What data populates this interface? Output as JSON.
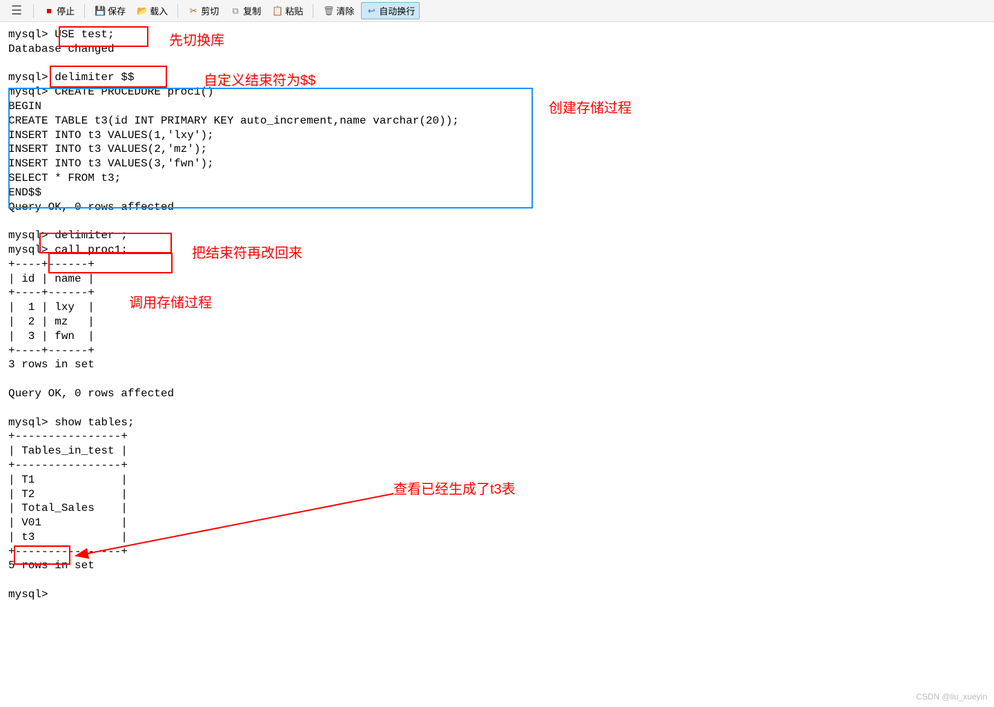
{
  "toolbar": {
    "stop": "停止",
    "save": "保存",
    "load": "载入",
    "cut": "剪切",
    "copy": "复制",
    "paste": "粘贴",
    "clear": "清除",
    "wordwrap": "自动换行"
  },
  "terminal": {
    "lines": [
      "mysql> USE test;",
      "Database changed",
      "",
      "mysql> delimiter $$",
      "mysql> CREATE PROCEDURE proc1()",
      "BEGIN",
      "CREATE TABLE t3(id INT PRIMARY KEY auto_increment,name varchar(20));",
      "INSERT INTO t3 VALUES(1,'lxy');",
      "INSERT INTO t3 VALUES(2,'mz');",
      "INSERT INTO t3 VALUES(3,'fwn');",
      "SELECT * FROM t3;",
      "END$$",
      "Query OK, 0 rows affected",
      "",
      "mysql> delimiter ;",
      "mysql> call proc1;",
      "+----+------+",
      "| id | name |",
      "+----+------+",
      "|  1 | lxy  |",
      "|  2 | mz   |",
      "|  3 | fwn  |",
      "+----+------+",
      "3 rows in set",
      "",
      "Query OK, 0 rows affected",
      "",
      "mysql> show tables;",
      "+----------------+",
      "| Tables_in_test |",
      "+----------------+",
      "| T1             |",
      "| T2             |",
      "| Total_Sales    |",
      "| V01            |",
      "| t3             |",
      "+----------------+",
      "5 rows in set",
      "",
      "mysql> "
    ]
  },
  "annotations": {
    "switch_db": "先切换库",
    "custom_delim": "自定义结束符为$$",
    "create_proc": "创建存储过程",
    "restore_delim": "把结束符再改回来",
    "call_proc": "调用存储过程",
    "check_table": "查看已经生成了t3表"
  },
  "watermark": "CSDN @liu_xueyin"
}
